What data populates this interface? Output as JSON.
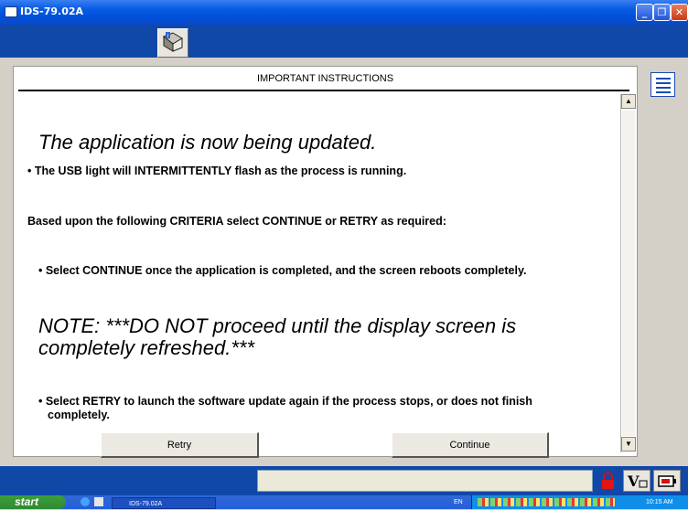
{
  "window": {
    "title": "IDS-79.02A",
    "minimize_glyph": "_",
    "restore_glyph": "❐",
    "close_glyph": "✕"
  },
  "panel": {
    "header": "IMPORTANT INSTRUCTIONS",
    "heading": "The application is now being updated.",
    "bullet1_prefix": "• The USB light will ",
    "bullet1_emph": "INTERMITTENTLY",
    "bullet1_suffix": " flash as the process is running.",
    "criteria": "Based upon the following CRITERIA select CONTINUE or RETRY as required:",
    "bullet2_prefix": "• Select ",
    "bullet2_emph": "CONTINUE",
    "bullet2_suffix": " once the application is completed, and the screen reboots completely.",
    "note_line1": "NOTE:  ***DO NOT proceed until the display screen is",
    "note_line2": "completely refreshed.***",
    "bullet3_prefix": "• Select ",
    "bullet3_emph": "RETRY",
    "bullet3_suffix": " to launch the software update again if the process stops, or does not finish",
    "bullet3_line2": "completely."
  },
  "buttons": {
    "retry": "Retry",
    "continue": "Continue"
  },
  "scrollbar": {
    "up": "▲",
    "down": "▼"
  },
  "taskbar": {
    "start": "start",
    "task_label": "IDS-79.02A",
    "lang": "EN",
    "time": "10:15 AM"
  },
  "icons": {
    "toolbar": "book-arrow-icon",
    "side": "list-icon",
    "status": [
      "lock-icon",
      "vehicle-v-icon",
      "battery-icon"
    ]
  }
}
